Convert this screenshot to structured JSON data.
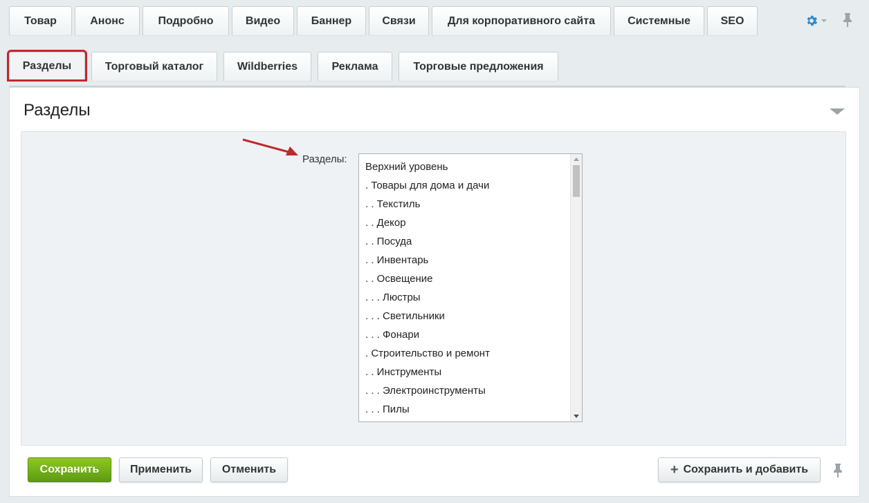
{
  "top_tabs": [
    "Товар",
    "Анонс",
    "Подробно",
    "Видео",
    "Баннер",
    "Связи",
    "Для корпоративного сайта",
    "Системные",
    "SEO"
  ],
  "sub_tabs": [
    "Разделы",
    "Торговый каталог",
    "Wildberries",
    "Реклама",
    "Торговые предложения"
  ],
  "active_sub_tab": "Разделы",
  "panel": {
    "title": "Разделы",
    "field_label": "Разделы:",
    "sections": [
      "Верхний уровень",
      ". Товары для дома и дачи",
      ". . Текстиль",
      ". . Декор",
      ". . Посуда",
      ". . Инвентарь",
      ". . Освещение",
      ". . . Люстры",
      ". . . Светильники",
      ". . . Фонари",
      ". Строительство и ремонт",
      ". . Инструменты",
      ". . . Электроинструменты",
      ". . . Пилы"
    ]
  },
  "buttons": {
    "save": "Сохранить",
    "apply": "Применить",
    "cancel": "Отменить",
    "save_and_add": "Сохранить и добавить"
  },
  "colors": {
    "accent_green": "#6aab18",
    "highlight_red": "#c0282d",
    "gear_blue": "#2a8bd1"
  },
  "icons": [
    "gear-icon",
    "chevron-down-icon",
    "pin-icon",
    "plus-icon",
    "collapse-arrow-icon"
  ]
}
